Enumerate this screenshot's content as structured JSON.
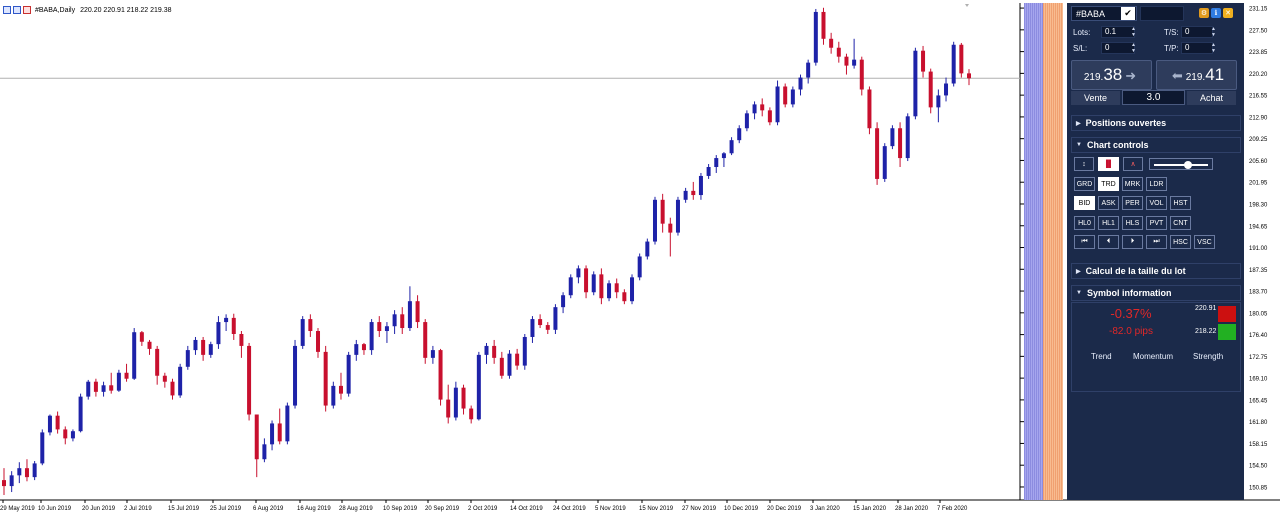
{
  "window": {
    "symbol_header": "#BABA,Daily",
    "ohlc": "220.20 220.91 218.22 219.38"
  },
  "chart_data": {
    "type": "candlestick",
    "symbol": "#BABA",
    "timeframe": "Daily",
    "ylim": [
      149.0,
      232.0
    ],
    "y_ticks": [
      "231.15",
      "227.50",
      "223.85",
      "220.20",
      "216.55",
      "212.90",
      "209.25",
      "205.60",
      "201.95",
      "198.30",
      "194.65",
      "191.00",
      "187.35",
      "183.70",
      "180.05",
      "176.40",
      "172.75",
      "169.10",
      "165.45",
      "161.80",
      "158.15",
      "154.50",
      "150.85"
    ],
    "current_price": "219.38",
    "x_labels": [
      "29 May 2019",
      "10 Jun 2019",
      "20 Jun 2019",
      "2 Jul 2019",
      "15 Jul 2019",
      "25 Jul 2019",
      "6 Aug 2019",
      "16 Aug 2019",
      "28 Aug 2019",
      "10 Sep 2019",
      "20 Sep 2019",
      "2 Oct 2019",
      "14 Oct 2019",
      "24 Oct 2019",
      "5 Nov 2019",
      "15 Nov 2019",
      "27 Nov 2019",
      "10 Dec 2019",
      "20 Dec 2019",
      "3 Jan 2020",
      "15 Jan 2020",
      "28 Jan 2020",
      "7 Feb 2020"
    ],
    "candles": [
      {
        "o": 152.0,
        "h": 154.0,
        "l": 149.5,
        "c": 151.0
      },
      {
        "o": 151.0,
        "h": 153.5,
        "l": 150.0,
        "c": 152.8
      },
      {
        "o": 152.8,
        "h": 155.0,
        "l": 151.5,
        "c": 154.0
      },
      {
        "o": 154.0,
        "h": 155.5,
        "l": 151.8,
        "c": 152.5
      },
      {
        "o": 152.5,
        "h": 155.2,
        "l": 152.0,
        "c": 154.8
      },
      {
        "o": 154.8,
        "h": 160.5,
        "l": 154.5,
        "c": 160.0
      },
      {
        "o": 160.0,
        "h": 163.0,
        "l": 159.5,
        "c": 162.8
      },
      {
        "o": 162.8,
        "h": 163.5,
        "l": 159.8,
        "c": 160.5
      },
      {
        "o": 160.5,
        "h": 161.0,
        "l": 158.0,
        "c": 159.0
      },
      {
        "o": 159.0,
        "h": 160.5,
        "l": 158.5,
        "c": 160.2
      },
      {
        "o": 160.2,
        "h": 166.5,
        "l": 160.0,
        "c": 166.0
      },
      {
        "o": 166.0,
        "h": 168.8,
        "l": 165.5,
        "c": 168.5
      },
      {
        "o": 168.5,
        "h": 169.0,
        "l": 166.0,
        "c": 166.8
      },
      {
        "o": 166.8,
        "h": 168.5,
        "l": 166.0,
        "c": 167.9
      },
      {
        "o": 167.9,
        "h": 170.0,
        "l": 166.5,
        "c": 167.0
      },
      {
        "o": 167.0,
        "h": 170.5,
        "l": 166.8,
        "c": 170.0
      },
      {
        "o": 170.0,
        "h": 171.5,
        "l": 168.5,
        "c": 169.0
      },
      {
        "o": 169.0,
        "h": 177.5,
        "l": 168.8,
        "c": 176.8
      },
      {
        "o": 176.8,
        "h": 177.0,
        "l": 174.5,
        "c": 175.2
      },
      {
        "o": 175.2,
        "h": 175.5,
        "l": 173.0,
        "c": 174.0
      },
      {
        "o": 174.0,
        "h": 174.5,
        "l": 168.0,
        "c": 169.5
      },
      {
        "o": 169.5,
        "h": 170.0,
        "l": 167.5,
        "c": 168.5
      },
      {
        "o": 168.5,
        "h": 169.0,
        "l": 165.5,
        "c": 166.2
      },
      {
        "o": 166.2,
        "h": 171.5,
        "l": 165.8,
        "c": 171.0
      },
      {
        "o": 171.0,
        "h": 174.5,
        "l": 170.5,
        "c": 173.8
      },
      {
        "o": 173.8,
        "h": 176.0,
        "l": 173.0,
        "c": 175.5
      },
      {
        "o": 175.5,
        "h": 176.0,
        "l": 172.0,
        "c": 173.0
      },
      {
        "o": 173.0,
        "h": 175.2,
        "l": 172.5,
        "c": 174.8
      },
      {
        "o": 174.8,
        "h": 179.5,
        "l": 174.0,
        "c": 178.5
      },
      {
        "o": 178.5,
        "h": 179.8,
        "l": 177.0,
        "c": 179.2
      },
      {
        "o": 179.2,
        "h": 179.9,
        "l": 175.5,
        "c": 176.5
      },
      {
        "o": 176.5,
        "h": 177.0,
        "l": 172.5,
        "c": 174.5
      },
      {
        "o": 174.5,
        "h": 175.0,
        "l": 162.0,
        "c": 163.0
      },
      {
        "o": 163.0,
        "h": 158.5,
        "l": 152.5,
        "c": 155.5
      },
      {
        "o": 155.5,
        "h": 159.0,
        "l": 155.0,
        "c": 158.0
      },
      {
        "o": 158.0,
        "h": 162.0,
        "l": 157.0,
        "c": 161.5
      },
      {
        "o": 161.5,
        "h": 164.0,
        "l": 158.0,
        "c": 158.5
      },
      {
        "o": 158.5,
        "h": 165.0,
        "l": 158.0,
        "c": 164.5
      },
      {
        "o": 164.5,
        "h": 175.5,
        "l": 164.0,
        "c": 174.5
      },
      {
        "o": 174.5,
        "h": 179.5,
        "l": 174.0,
        "c": 179.0
      },
      {
        "o": 179.0,
        "h": 179.8,
        "l": 176.0,
        "c": 177.0
      },
      {
        "o": 177.0,
        "h": 177.5,
        "l": 172.5,
        "c": 173.5
      },
      {
        "o": 173.5,
        "h": 174.5,
        "l": 163.5,
        "c": 164.5
      },
      {
        "o": 164.5,
        "h": 168.5,
        "l": 164.0,
        "c": 167.8
      },
      {
        "o": 167.8,
        "h": 170.0,
        "l": 165.5,
        "c": 166.5
      },
      {
        "o": 166.5,
        "h": 173.5,
        "l": 166.0,
        "c": 173.0
      },
      {
        "o": 173.0,
        "h": 175.5,
        "l": 172.0,
        "c": 174.8
      },
      {
        "o": 174.8,
        "h": 175.0,
        "l": 173.0,
        "c": 173.8
      },
      {
        "o": 173.8,
        "h": 179.0,
        "l": 173.0,
        "c": 178.5
      },
      {
        "o": 178.5,
        "h": 179.5,
        "l": 176.0,
        "c": 177.0
      },
      {
        "o": 177.0,
        "h": 178.5,
        "l": 175.0,
        "c": 177.8
      },
      {
        "o": 177.8,
        "h": 180.5,
        "l": 176.5,
        "c": 179.8
      },
      {
        "o": 179.8,
        "h": 181.0,
        "l": 176.5,
        "c": 177.5
      },
      {
        "o": 177.5,
        "h": 184.5,
        "l": 177.0,
        "c": 182.0
      },
      {
        "o": 182.0,
        "h": 183.0,
        "l": 177.5,
        "c": 178.5
      },
      {
        "o": 178.5,
        "h": 179.0,
        "l": 171.5,
        "c": 172.5
      },
      {
        "o": 172.5,
        "h": 174.5,
        "l": 171.5,
        "c": 173.8
      },
      {
        "o": 173.8,
        "h": 174.0,
        "l": 164.5,
        "c": 165.5
      },
      {
        "o": 165.5,
        "h": 168.0,
        "l": 161.5,
        "c": 162.5
      },
      {
        "o": 162.5,
        "h": 168.5,
        "l": 162.0,
        "c": 167.5
      },
      {
        "o": 167.5,
        "h": 168.0,
        "l": 163.0,
        "c": 164.0
      },
      {
        "o": 164.0,
        "h": 164.5,
        "l": 161.5,
        "c": 162.2
      },
      {
        "o": 162.2,
        "h": 173.5,
        "l": 162.0,
        "c": 173.0
      },
      {
        "o": 173.0,
        "h": 175.0,
        "l": 171.5,
        "c": 174.5
      },
      {
        "o": 174.5,
        "h": 175.5,
        "l": 171.5,
        "c": 172.5
      },
      {
        "o": 172.5,
        "h": 173.5,
        "l": 169.0,
        "c": 169.5
      },
      {
        "o": 169.5,
        "h": 173.8,
        "l": 169.0,
        "c": 173.2
      },
      {
        "o": 173.2,
        "h": 174.0,
        "l": 170.5,
        "c": 171.2
      },
      {
        "o": 171.2,
        "h": 176.5,
        "l": 170.5,
        "c": 176.0
      },
      {
        "o": 176.0,
        "h": 179.5,
        "l": 175.0,
        "c": 179.0
      },
      {
        "o": 179.0,
        "h": 179.8,
        "l": 177.5,
        "c": 178.0
      },
      {
        "o": 178.0,
        "h": 178.5,
        "l": 176.5,
        "c": 177.2
      },
      {
        "o": 177.2,
        "h": 181.5,
        "l": 176.5,
        "c": 181.0
      },
      {
        "o": 181.0,
        "h": 183.5,
        "l": 180.0,
        "c": 183.0
      },
      {
        "o": 183.0,
        "h": 186.5,
        "l": 182.5,
        "c": 186.0
      },
      {
        "o": 186.0,
        "h": 188.0,
        "l": 185.0,
        "c": 187.5
      },
      {
        "o": 187.5,
        "h": 188.0,
        "l": 182.5,
        "c": 183.5
      },
      {
        "o": 183.5,
        "h": 187.0,
        "l": 183.0,
        "c": 186.5
      },
      {
        "o": 186.5,
        "h": 187.5,
        "l": 181.5,
        "c": 182.5
      },
      {
        "o": 182.5,
        "h": 185.5,
        "l": 182.0,
        "c": 185.0
      },
      {
        "o": 185.0,
        "h": 185.8,
        "l": 182.5,
        "c": 183.5
      },
      {
        "o": 183.5,
        "h": 184.0,
        "l": 181.5,
        "c": 182.0
      },
      {
        "o": 182.0,
        "h": 186.5,
        "l": 181.5,
        "c": 186.0
      },
      {
        "o": 186.0,
        "h": 190.0,
        "l": 185.5,
        "c": 189.5
      },
      {
        "o": 189.5,
        "h": 192.5,
        "l": 189.0,
        "c": 192.0
      },
      {
        "o": 192.0,
        "h": 199.5,
        "l": 191.5,
        "c": 199.0
      },
      {
        "o": 199.0,
        "h": 200.0,
        "l": 193.5,
        "c": 195.0
      },
      {
        "o": 195.0,
        "h": 196.0,
        "l": 189.5,
        "c": 193.5
      },
      {
        "o": 193.5,
        "h": 199.5,
        "l": 193.0,
        "c": 199.0
      },
      {
        "o": 199.0,
        "h": 201.0,
        "l": 198.5,
        "c": 200.5
      },
      {
        "o": 200.5,
        "h": 202.0,
        "l": 199.0,
        "c": 199.8
      },
      {
        "o": 199.8,
        "h": 203.5,
        "l": 199.0,
        "c": 203.0
      },
      {
        "o": 203.0,
        "h": 205.0,
        "l": 202.5,
        "c": 204.5
      },
      {
        "o": 204.5,
        "h": 206.5,
        "l": 203.5,
        "c": 206.0
      },
      {
        "o": 206.0,
        "h": 207.0,
        "l": 204.5,
        "c": 206.8
      },
      {
        "o": 206.8,
        "h": 209.5,
        "l": 206.5,
        "c": 209.0
      },
      {
        "o": 209.0,
        "h": 211.5,
        "l": 208.5,
        "c": 211.0
      },
      {
        "o": 211.0,
        "h": 214.0,
        "l": 210.5,
        "c": 213.5
      },
      {
        "o": 213.5,
        "h": 215.5,
        "l": 212.5,
        "c": 215.0
      },
      {
        "o": 215.0,
        "h": 216.0,
        "l": 213.0,
        "c": 214.0
      },
      {
        "o": 214.0,
        "h": 214.5,
        "l": 211.5,
        "c": 212.0
      },
      {
        "o": 212.0,
        "h": 219.0,
        "l": 211.5,
        "c": 218.0
      },
      {
        "o": 218.0,
        "h": 218.5,
        "l": 214.5,
        "c": 215.0
      },
      {
        "o": 215.0,
        "h": 218.0,
        "l": 214.5,
        "c": 217.5
      },
      {
        "o": 217.5,
        "h": 220.0,
        "l": 216.5,
        "c": 219.5
      },
      {
        "o": 219.5,
        "h": 222.5,
        "l": 218.5,
        "c": 222.0
      },
      {
        "o": 222.0,
        "h": 231.0,
        "l": 221.5,
        "c": 230.5
      },
      {
        "o": 230.5,
        "h": 231.2,
        "l": 225.0,
        "c": 226.0
      },
      {
        "o": 226.0,
        "h": 227.0,
        "l": 223.5,
        "c": 224.5
      },
      {
        "o": 224.5,
        "h": 225.5,
        "l": 222.0,
        "c": 223.0
      },
      {
        "o": 223.0,
        "h": 223.5,
        "l": 220.0,
        "c": 221.5
      },
      {
        "o": 221.5,
        "h": 226.0,
        "l": 221.0,
        "c": 222.5
      },
      {
        "o": 222.5,
        "h": 223.0,
        "l": 216.5,
        "c": 217.5
      },
      {
        "o": 217.5,
        "h": 218.0,
        "l": 210.0,
        "c": 211.0
      },
      {
        "o": 211.0,
        "h": 212.0,
        "l": 201.5,
        "c": 202.5
      },
      {
        "o": 202.5,
        "h": 208.5,
        "l": 202.0,
        "c": 208.0
      },
      {
        "o": 208.0,
        "h": 211.5,
        "l": 207.5,
        "c": 211.0
      },
      {
        "o": 211.0,
        "h": 212.0,
        "l": 204.5,
        "c": 206.0
      },
      {
        "o": 206.0,
        "h": 213.5,
        "l": 205.5,
        "c": 213.0
      },
      {
        "o": 213.0,
        "h": 224.5,
        "l": 212.5,
        "c": 224.0
      },
      {
        "o": 224.0,
        "h": 224.8,
        "l": 219.5,
        "c": 220.5
      },
      {
        "o": 220.5,
        "h": 221.0,
        "l": 213.5,
        "c": 214.5
      },
      {
        "o": 214.5,
        "h": 217.5,
        "l": 212.0,
        "c": 216.5
      },
      {
        "o": 216.5,
        "h": 219.5,
        "l": 215.5,
        "c": 218.5
      },
      {
        "o": 218.5,
        "h": 225.5,
        "l": 218.0,
        "c": 225.0
      },
      {
        "o": 225.0,
        "h": 225.3,
        "l": 219.5,
        "c": 220.2
      },
      {
        "o": 220.2,
        "h": 220.91,
        "l": 218.22,
        "c": 219.38
      }
    ]
  },
  "colors": {
    "bull": "#1e22a8",
    "bear": "#c8102e",
    "panel_bg": "#1b2a4a",
    "sell_red": "#e02828",
    "low_green": "#22b022",
    "high_red": "#cc1010"
  },
  "panel": {
    "symbol": "#BABA",
    "lots_label": "Lots:",
    "lots_value": "0.1",
    "sl_label": "S/L:",
    "sl_value": "0",
    "ts_label": "T/S:",
    "ts_value": "0",
    "tp_label": "T/P:",
    "tp_value": "0",
    "sell_small": "219.",
    "sell_big": "38",
    "buy_small": "219.",
    "buy_big": "41",
    "sell_label": "Vente",
    "buy_label": "Achat",
    "quantity": "3.0",
    "positions_title": "Positions ouvertes",
    "chart_controls_title": "Chart controls",
    "buttons_row1": [
      "GRD",
      "TRD",
      "MRK",
      "LDR"
    ],
    "buttons_row2": [
      "BID",
      "ASK",
      "PER",
      "VOL",
      "HST"
    ],
    "buttons_row3": [
      "HL0",
      "HL1",
      "HLS",
      "PVT",
      "CNT"
    ],
    "nav_icons": [
      "skip-first-icon",
      "step-back-icon",
      "step-forward-icon",
      "skip-last-icon"
    ],
    "buttons_row4": [
      "HSC",
      "VSC"
    ],
    "slider_level": 0.62,
    "lot_size_title": "Calcul de la taille du lot",
    "symbol_info_title": "Symbol information",
    "change_pct": "-0.37%",
    "change_pips": "-82.0 pips",
    "day_high": "220.91",
    "day_low": "218.22",
    "metric_trend": "Trend",
    "metric_momentum": "Momentum",
    "metric_strength": "Strength"
  }
}
